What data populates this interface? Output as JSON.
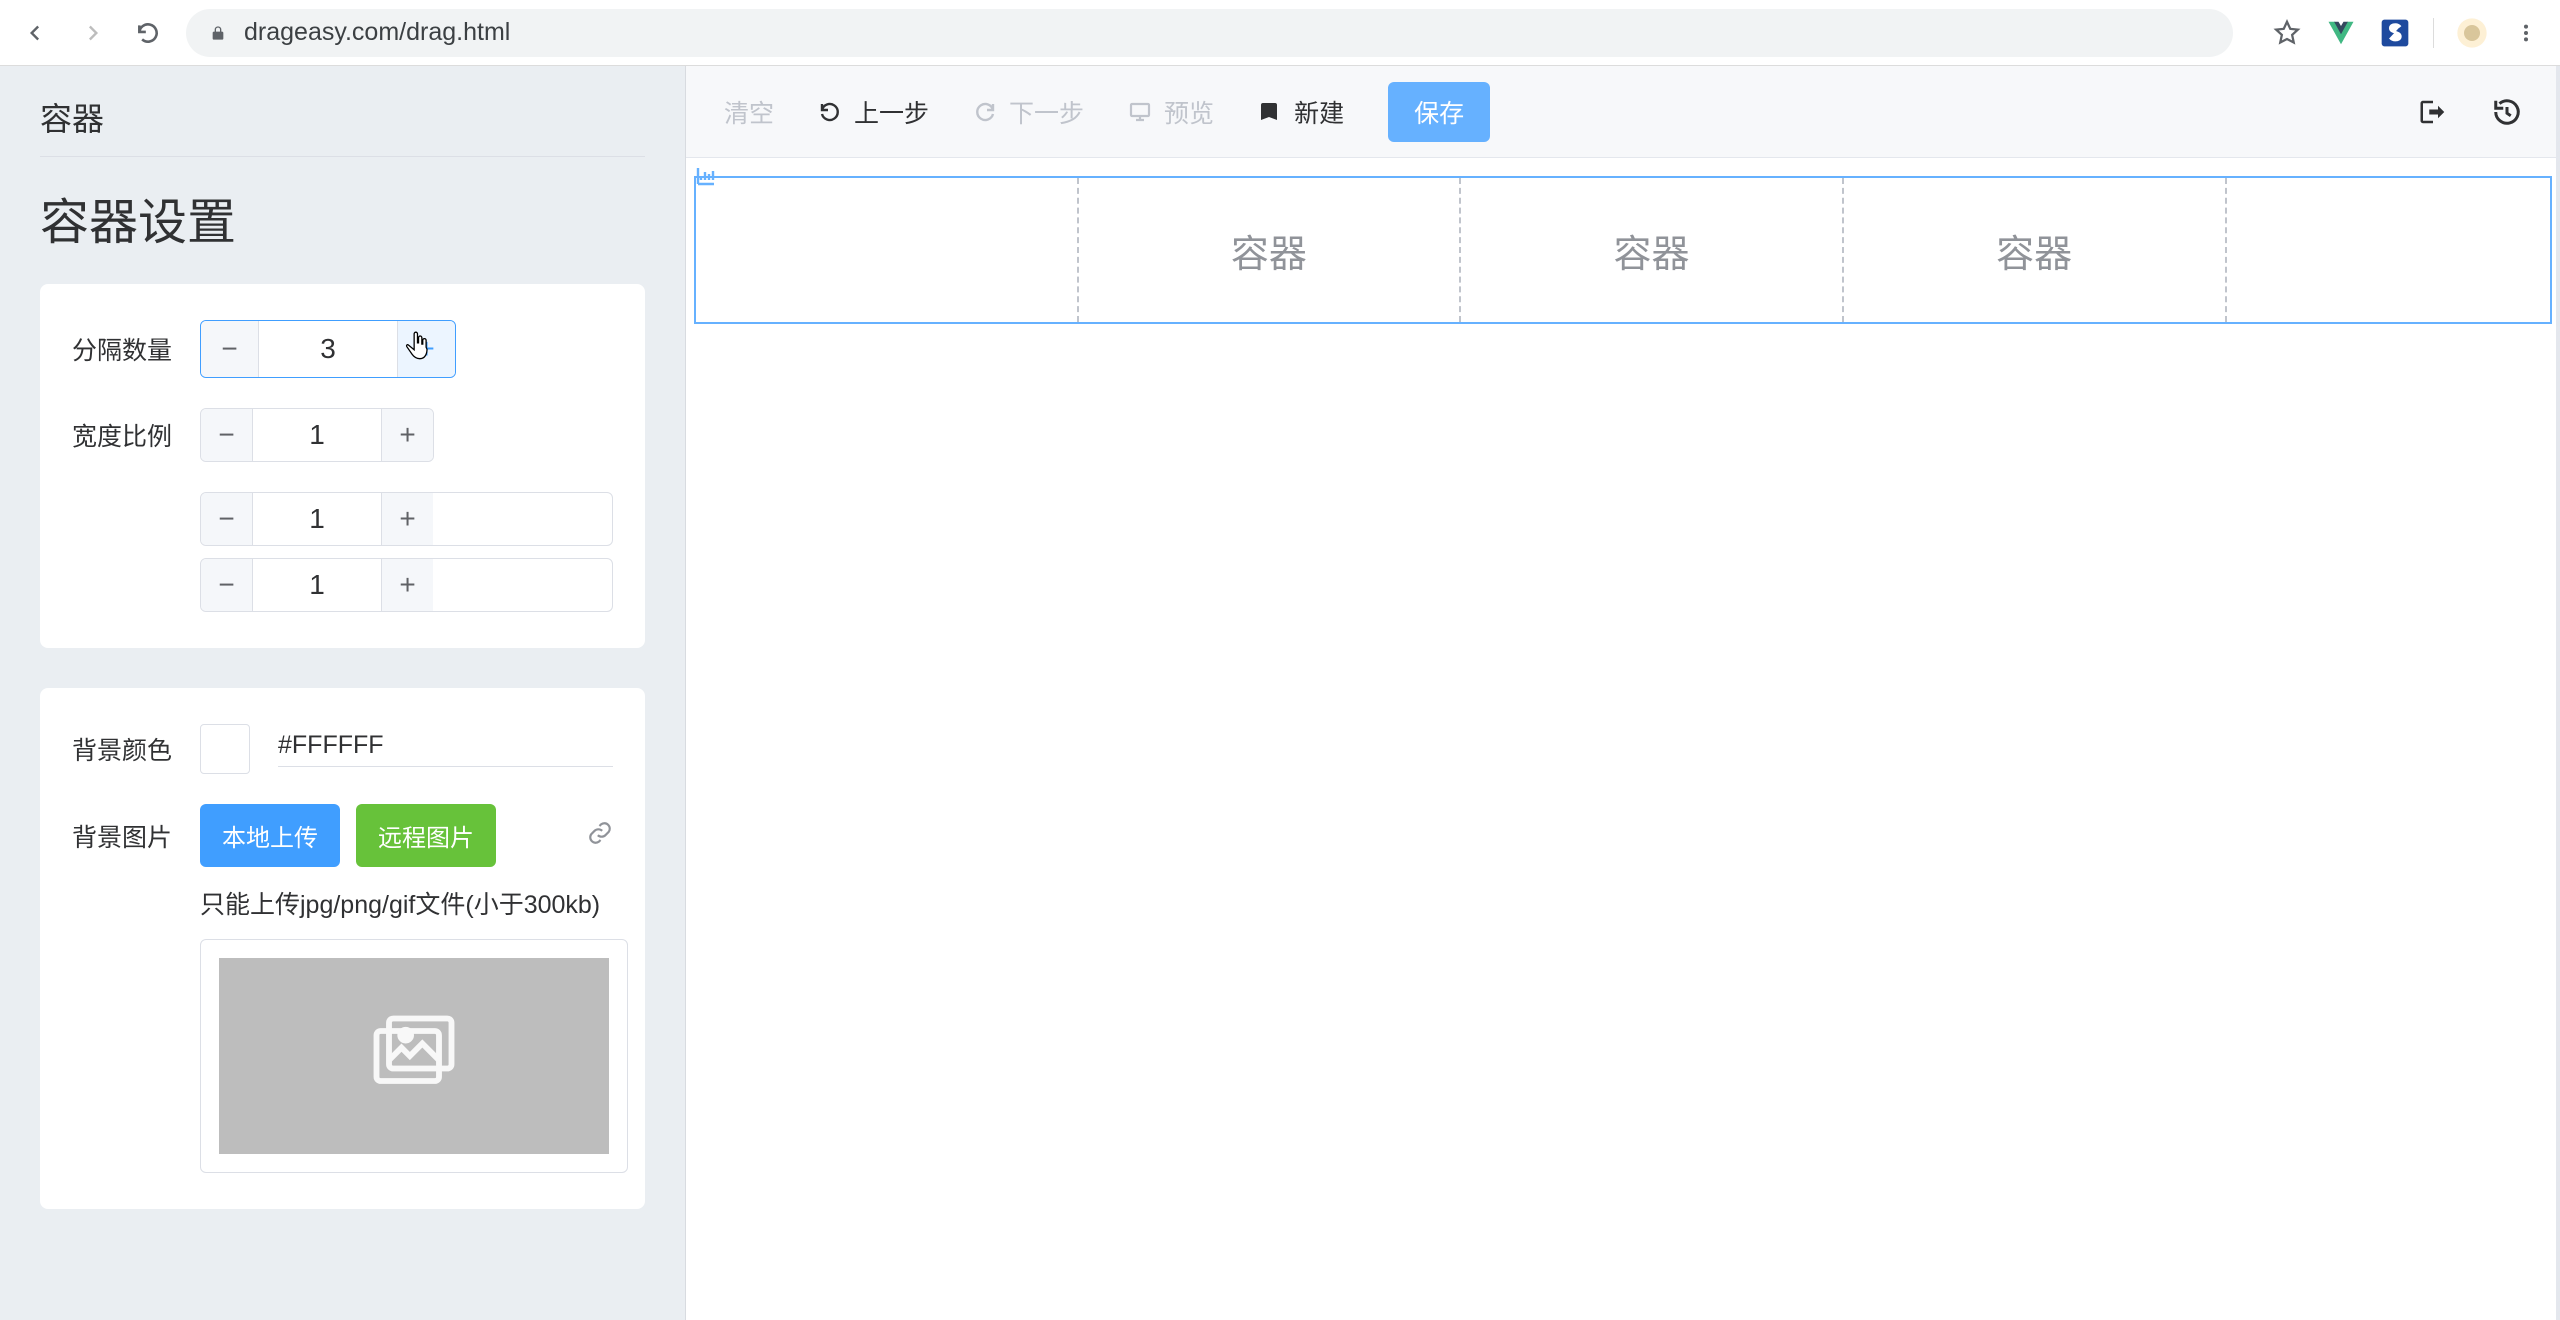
{
  "browser": {
    "url": "drageasy.com/drag.html"
  },
  "sidebar": {
    "heading_small": "容器",
    "heading_big": "容器设置",
    "split_count_label": "分隔数量",
    "split_count": "3",
    "width_ratio_label": "宽度比例",
    "ratio_1": "1",
    "ratio_2": "1",
    "ratio_3": "1",
    "bg_color_label": "背景颜色",
    "bg_color_hex": "#FFFFFF",
    "bg_image_label": "背景图片",
    "btn_local_upload": "本地上传",
    "btn_remote_image": "远程图片",
    "upload_hint": "只能上传jpg/png/gif文件(小于300kb)"
  },
  "toolbar": {
    "clear": "清空",
    "undo": "上一步",
    "redo": "下一步",
    "preview": "预览",
    "new": "新建",
    "save": "保存"
  },
  "canvas": {
    "col_label": "容器"
  }
}
